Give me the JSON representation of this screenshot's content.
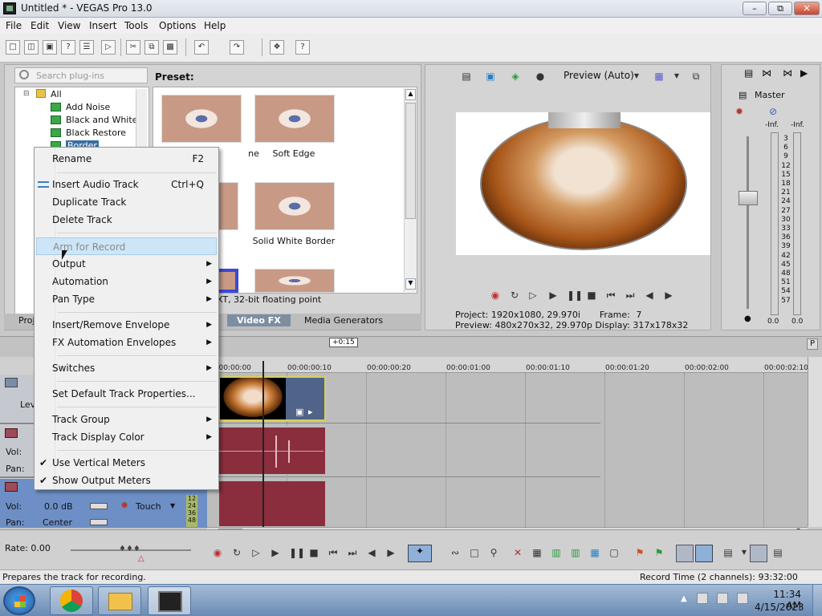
{
  "window": {
    "title": "Untitled * - VEGAS Pro 13.0"
  },
  "menu": [
    "File",
    "Edit",
    "View",
    "Insert",
    "Tools",
    "Options",
    "Help"
  ],
  "fx": {
    "search_placeholder": "Search plug-ins",
    "tree": [
      "All",
      "Add Noise",
      "Black and White",
      "Black Restore",
      "Border"
    ],
    "preset_label": "Preset:",
    "presets": [
      "Soft Edge",
      "Solid White Border"
    ],
    "cut_caption": "ne",
    "info": "XT, 32-bit floating point",
    "tabs": [
      "Proj",
      "Video FX",
      "Media Generators"
    ]
  },
  "preview": {
    "mode": "Preview (Auto)",
    "project_label": "Project:",
    "project_value": "1920x1080, 29.970i",
    "frame_label": "Frame:",
    "frame_value": "7",
    "preview_label": "Preview:",
    "preview_value": "480x270x32, 29.970p",
    "display_label": "Display:",
    "display_value": "317x178x32"
  },
  "master": {
    "label": "Master",
    "inf_left": "-Inf.",
    "inf_right": "-Inf.",
    "scale": [
      "3",
      "6",
      "9",
      "12",
      "15",
      "18",
      "21",
      "24",
      "27",
      "30",
      "33",
      "36",
      "39",
      "42",
      "45",
      "48",
      "51",
      "54",
      "57"
    ],
    "bottom_left": "0.0",
    "bottom_right": "0.0"
  },
  "timeline": {
    "ticks": [
      "00:00:00:00",
      "00:00:00:10",
      "00:00:00:20",
      "00:00:01:00",
      "00:00:01:10",
      "00:00:01:20",
      "00:00:02:00",
      "00:00:02:10"
    ],
    "offset": "+0:15"
  },
  "tracks": {
    "video_label": "Lev",
    "vol_label": "Vol:",
    "pan_label": "Pan:",
    "vol_value": "0.0 dB",
    "pan_value": "Center",
    "touch": "Touch",
    "meter_scale": [
      "12",
      "24",
      "36",
      "48"
    ]
  },
  "context_menu": {
    "items": [
      {
        "label": "Rename",
        "accel": "F2"
      },
      {
        "label": "Insert Audio Track",
        "accel": "Ctrl+Q"
      },
      {
        "label": "Duplicate Track"
      },
      {
        "label": "Delete Track"
      },
      {
        "label": "Arm for Record"
      },
      {
        "label": "Output"
      },
      {
        "label": "Automation"
      },
      {
        "label": "Pan Type"
      },
      {
        "label": "Insert/Remove Envelope"
      },
      {
        "label": "FX Automation Envelopes"
      },
      {
        "label": "Switches"
      },
      {
        "label": "Set Default Track Properties..."
      },
      {
        "label": "Track Group"
      },
      {
        "label": "Track Display Color"
      },
      {
        "label": "Use Vertical Meters",
        "checked": true
      },
      {
        "label": "Show Output Meters",
        "checked": true
      }
    ]
  },
  "transport": {
    "rate": "Rate: 0.00"
  },
  "status": {
    "message": "Prepares the track for recording.",
    "record_time": "Record Time (2 channels): 93:32:00"
  },
  "taskbar": {
    "time": "11:34 AM",
    "date": "4/15/2023"
  }
}
